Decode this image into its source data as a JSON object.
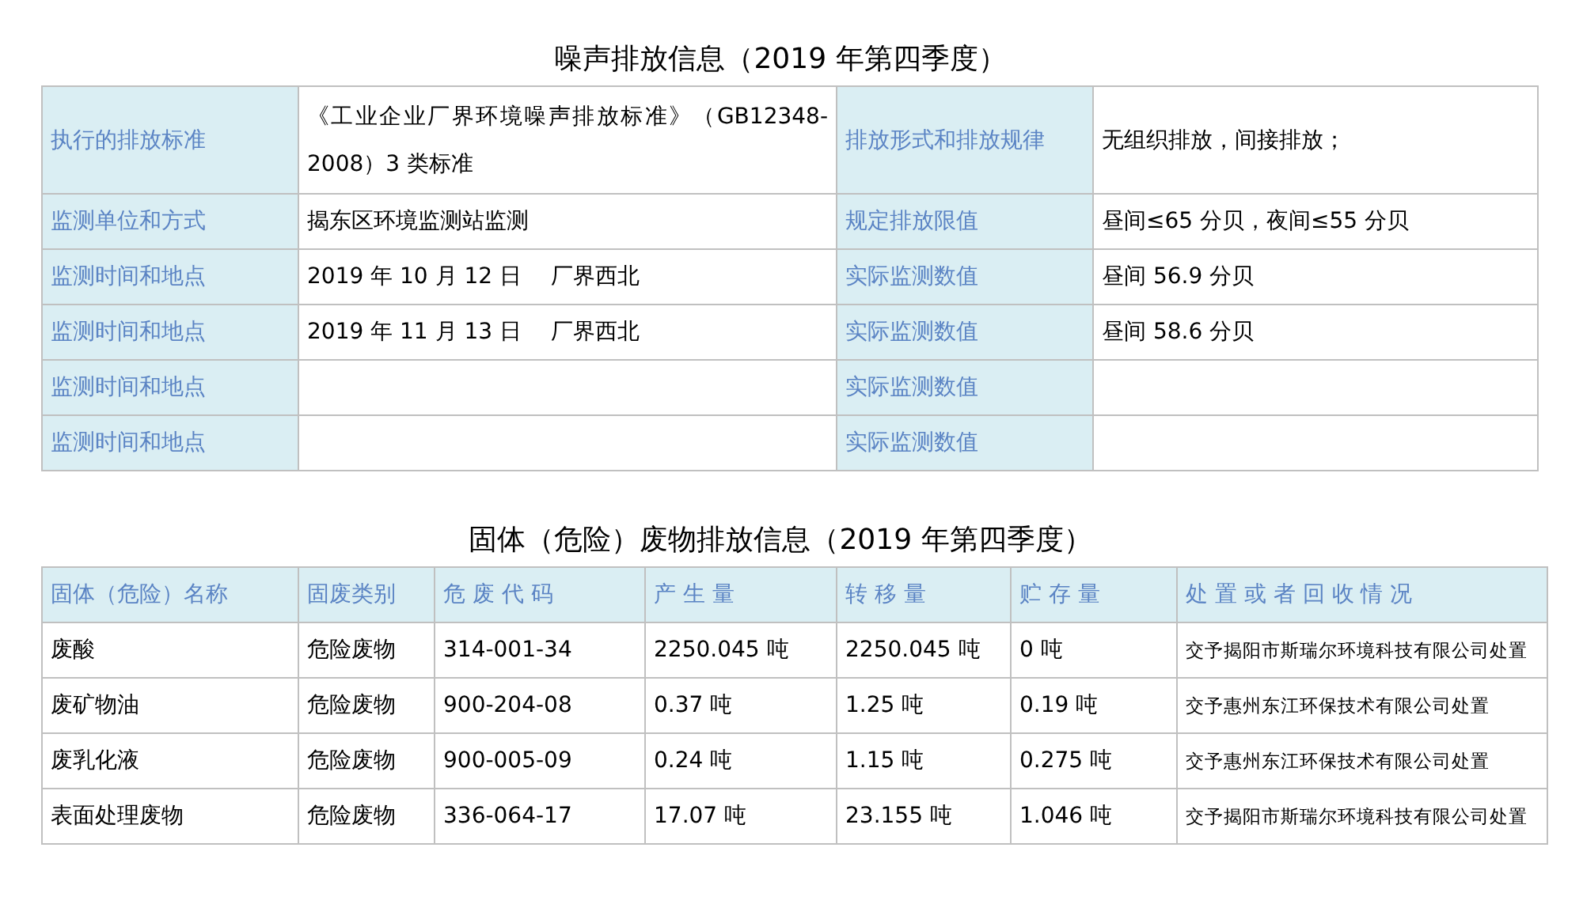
{
  "noise_section": {
    "title": "噪声排放信息（2019 年第四季度）",
    "rows": [
      {
        "label_1": "执行的排放标准",
        "value_1": "《工业企业厂界环境噪声排放标准》（GB12348-2008）3 类标准",
        "label_2": "排放形式和排放规律",
        "value_2": "无组织排放，间接排放；"
      },
      {
        "label_1": "监测单位和方式",
        "value_1": "揭东区环境监测站监测",
        "label_2": "规定排放限值",
        "value_2": "昼间≤65 分贝，夜间≤55 分贝"
      },
      {
        "label_1": "监测时间和地点",
        "value_1": "2019 年 10 月 12 日　 厂界西北",
        "label_2": "实际监测数值",
        "value_2": "昼间 56.9 分贝"
      },
      {
        "label_1": "监测时间和地点",
        "value_1": "2019 年 11 月 13 日　 厂界西北",
        "label_2": "实际监测数值",
        "value_2": "昼间 58.6 分贝"
      },
      {
        "label_1": "监测时间和地点",
        "label_2": "实际监测数值"
      },
      {
        "label_1": "监测时间和地点",
        "label_2": "实际监测数值"
      }
    ]
  },
  "waste_section": {
    "title": "固体（危险）废物排放信息（2019 年第四季度）",
    "columns": [
      "固体（危险）名称",
      "固废类别",
      "危 废 代 码",
      "产 生 量",
      "转 移 量",
      "贮 存 量",
      "处 置 或 者 回 收 情 况"
    ],
    "rows": [
      [
        "废酸",
        "危险废物",
        "314-001-34",
        "2250.045 吨",
        "2250.045 吨",
        "0 吨",
        "交予揭阳市斯瑞尔环境科技有限公司处置"
      ],
      [
        "废矿物油",
        "危险废物",
        "900-204-08",
        "0.37 吨",
        "1.25 吨",
        "0.19 吨",
        "交予惠州东江环保技术有限公司处置"
      ],
      [
        "废乳化液",
        "危险废物",
        "900-005-09",
        "0.24 吨",
        "1.15 吨",
        "0.275 吨",
        "交予惠州东江环保技术有限公司处置"
      ],
      [
        "表面处理废物",
        "危险废物",
        "336-064-17",
        "17.07 吨",
        "23.155 吨",
        "1.046 吨",
        "交予揭阳市斯瑞尔环境科技有限公司处置"
      ]
    ]
  }
}
